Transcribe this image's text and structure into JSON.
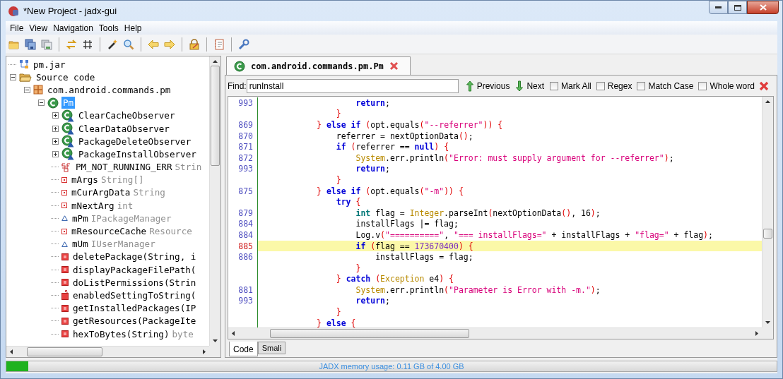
{
  "window": {
    "title": "*New Project - jadx-gui"
  },
  "menu": [
    "File",
    "View",
    "Navigation",
    "Tools",
    "Help"
  ],
  "tree": {
    "items": [
      {
        "label": "pm.jar",
        "kind": "jar",
        "selected": false
      },
      {
        "label": "Source code",
        "kind": "folder",
        "expanded": true,
        "selected": false,
        "children": [
          {
            "label": "com.android.commands.pm",
            "kind": "package",
            "expanded": true,
            "selected": false,
            "children": [
              {
                "label": "Pm",
                "kind": "class",
                "expanded": true,
                "selected": true,
                "children": [
                  {
                    "label": "ClearCacheObserver",
                    "kind": "inner-class",
                    "expanded": false,
                    "selected": false
                  },
                  {
                    "label": "ClearDataObserver",
                    "kind": "inner-class",
                    "expanded": false,
                    "selected": false
                  },
                  {
                    "label": "PackageDeleteObserver",
                    "kind": "inner-class",
                    "expanded": false,
                    "selected": false
                  },
                  {
                    "label": "PackageInstallObserver",
                    "kind": "inner-class",
                    "expanded": false,
                    "selected": false
                  },
                  {
                    "label": "PM_NOT_RUNNING_ERR",
                    "detail": "Strin",
                    "kind": "static-final-field",
                    "selected": false
                  },
                  {
                    "label": "mArgs",
                    "detail": "String[]",
                    "kind": "private-field",
                    "selected": false
                  },
                  {
                    "label": "mCurArgData",
                    "detail": "String",
                    "kind": "private-field",
                    "selected": false
                  },
                  {
                    "label": "mNextArg",
                    "detail": "int",
                    "kind": "private-field",
                    "selected": false
                  },
                  {
                    "label": "mPm",
                    "detail": "IPackageManager",
                    "kind": "package-field",
                    "selected": false
                  },
                  {
                    "label": "mResourceCache",
                    "detail": "Resource",
                    "kind": "private-field",
                    "selected": false
                  },
                  {
                    "label": "mUm",
                    "detail": "IUserManager",
                    "kind": "package-field",
                    "selected": false
                  },
                  {
                    "label": "deletePackage(String, i",
                    "kind": "method",
                    "selected": false
                  },
                  {
                    "label": "displayPackageFilePath(",
                    "kind": "method",
                    "selected": false
                  },
                  {
                    "label": "doListPermissions(Strin",
                    "kind": "method",
                    "selected": false
                  },
                  {
                    "label": "enabledSettingToString(",
                    "kind": "static-method",
                    "selected": false
                  },
                  {
                    "label": "getInstalledPackages(IP",
                    "kind": "method",
                    "selected": false
                  },
                  {
                    "label": "getResources(PackageIte",
                    "kind": "method",
                    "selected": false
                  },
                  {
                    "label": "hexToBytes(String)",
                    "detail": "byte",
                    "kind": "method",
                    "selected": false
                  }
                ]
              }
            ]
          }
        ]
      }
    ]
  },
  "editor_tab": {
    "label": "com.android.commands.pm.Pm",
    "selected": true
  },
  "find_bar": {
    "label": "Find:",
    "value": "runInstall",
    "buttons": [
      {
        "label": "Previous",
        "kind": "up"
      },
      {
        "label": "Next",
        "kind": "down"
      }
    ],
    "options": [
      {
        "label": "Mark All",
        "checked": false
      },
      {
        "label": "Regex",
        "checked": false
      },
      {
        "label": "Match Case",
        "checked": false
      },
      {
        "label": "Whole word",
        "checked": false
      }
    ]
  },
  "code": {
    "lines": [
      {
        "number": "993",
        "highlighted": false,
        "tokens": [
          {
            "text": "                    return",
            "kind": "kw"
          },
          {
            "text": ";",
            "kind": "plain"
          }
        ]
      },
      {
        "highlighted": false,
        "tokens": [
          {
            "text": "                }",
            "kind": "brace"
          }
        ]
      },
      {
        "number": "869",
        "highlighted": false,
        "tokens": [
          {
            "text": "            } ",
            "kind": "brace"
          },
          {
            "text": "else if ",
            "kind": "kw"
          },
          {
            "text": "(",
            "kind": "brace"
          },
          {
            "text": "opt.equals",
            "kind": "plain"
          },
          {
            "text": "(",
            "kind": "brace"
          },
          {
            "text": "\"--referrer\"",
            "kind": "str"
          },
          {
            "text": ")) {",
            "kind": "brace"
          }
        ]
      },
      {
        "number": "870",
        "highlighted": false,
        "tokens": [
          {
            "text": "                referrer = nextOptionData",
            "kind": "plain"
          },
          {
            "text": "()",
            "kind": "brace"
          },
          {
            "text": ";",
            "kind": "plain"
          }
        ]
      },
      {
        "number": "871",
        "highlighted": false,
        "tokens": [
          {
            "text": "                if ",
            "kind": "kw"
          },
          {
            "text": "(",
            "kind": "brace"
          },
          {
            "text": "referrer == ",
            "kind": "plain"
          },
          {
            "text": "null",
            "kind": "kw"
          },
          {
            "text": ") {",
            "kind": "brace"
          }
        ]
      },
      {
        "number": "872",
        "highlighted": false,
        "tokens": [
          {
            "text": "                    System",
            "kind": "type"
          },
          {
            "text": ".err.println",
            "kind": "plain"
          },
          {
            "text": "(",
            "kind": "brace"
          },
          {
            "text": "\"Error: must supply argument for --referrer\"",
            "kind": "str"
          },
          {
            "text": ")",
            "kind": "brace"
          },
          {
            "text": ";",
            "kind": "plain"
          }
        ]
      },
      {
        "number": "993",
        "highlighted": false,
        "tokens": [
          {
            "text": "                    return",
            "kind": "kw"
          },
          {
            "text": ";",
            "kind": "plain"
          }
        ]
      },
      {
        "highlighted": false,
        "tokens": [
          {
            "text": "                }",
            "kind": "brace"
          }
        ]
      },
      {
        "number": "875",
        "highlighted": false,
        "tokens": [
          {
            "text": "            } ",
            "kind": "brace"
          },
          {
            "text": "else if ",
            "kind": "kw"
          },
          {
            "text": "(",
            "kind": "brace"
          },
          {
            "text": "opt.equals",
            "kind": "plain"
          },
          {
            "text": "(",
            "kind": "brace"
          },
          {
            "text": "\"-m\"",
            "kind": "str"
          },
          {
            "text": ")) {",
            "kind": "brace"
          }
        ]
      },
      {
        "highlighted": false,
        "tokens": [
          {
            "text": "                try ",
            "kind": "kw"
          },
          {
            "text": "{",
            "kind": "brace"
          }
        ]
      },
      {
        "number": "879",
        "highlighted": false,
        "tokens": [
          {
            "text": "                    int",
            "kind": "prim"
          },
          {
            "text": " flag = ",
            "kind": "plain"
          },
          {
            "text": "Integer",
            "kind": "type"
          },
          {
            "text": ".parseInt",
            "kind": "plain"
          },
          {
            "text": "(",
            "kind": "brace"
          },
          {
            "text": "nextOptionData",
            "kind": "plain"
          },
          {
            "text": "()",
            "kind": "brace"
          },
          {
            "text": ", 16",
            "kind": "plain"
          },
          {
            "text": ")",
            "kind": "brace"
          },
          {
            "text": ";",
            "kind": "plain"
          }
        ]
      },
      {
        "number": "884",
        "highlighted": false,
        "tokens": [
          {
            "text": "                    installFlags |= flag;",
            "kind": "plain"
          }
        ]
      },
      {
        "number": "884",
        "highlighted": false,
        "tokens": [
          {
            "text": "                    Log.v",
            "kind": "plain"
          },
          {
            "text": "(",
            "kind": "brace"
          },
          {
            "text": "\"==========\"",
            "kind": "str"
          },
          {
            "text": ", ",
            "kind": "plain"
          },
          {
            "text": "\"=== installFlags=\"",
            "kind": "str"
          },
          {
            "text": " + installFlags + ",
            "kind": "plain"
          },
          {
            "text": "\"flag=\"",
            "kind": "str"
          },
          {
            "text": " + flag",
            "kind": "plain"
          },
          {
            "text": ")",
            "kind": "brace"
          },
          {
            "text": ";",
            "kind": "plain"
          }
        ]
      },
      {
        "number": "885",
        "highlighted": true,
        "tokens": [
          {
            "text": "                    if ",
            "kind": "kw"
          },
          {
            "text": "(",
            "kind": "brace"
          },
          {
            "text": "flag == ",
            "kind": "plain"
          },
          {
            "text": "173670400",
            "kind": "num"
          },
          {
            "text": ") {",
            "kind": "brace"
          }
        ]
      },
      {
        "number": "886",
        "highlighted": false,
        "tokens": [
          {
            "text": "                        installFlags = flag;",
            "kind": "plain"
          }
        ]
      },
      {
        "highlighted": false,
        "tokens": [
          {
            "text": "                    }",
            "kind": "brace"
          }
        ]
      },
      {
        "highlighted": false,
        "tokens": [
          {
            "text": "                } ",
            "kind": "brace"
          },
          {
            "text": "catch ",
            "kind": "kw"
          },
          {
            "text": "(",
            "kind": "brace"
          },
          {
            "text": "Exception",
            "kind": "type"
          },
          {
            "text": " e4",
            "kind": "plain"
          },
          {
            "text": ") {",
            "kind": "brace"
          }
        ]
      },
      {
        "number": "881",
        "highlighted": false,
        "tokens": [
          {
            "text": "                    System",
            "kind": "type"
          },
          {
            "text": ".err.println",
            "kind": "plain"
          },
          {
            "text": "(",
            "kind": "brace"
          },
          {
            "text": "\"Parameter is Error with -m.\"",
            "kind": "str"
          },
          {
            "text": ")",
            "kind": "brace"
          },
          {
            "text": ";",
            "kind": "plain"
          }
        ]
      },
      {
        "number": "993",
        "highlighted": false,
        "tokens": [
          {
            "text": "                    return",
            "kind": "kw"
          },
          {
            "text": ";",
            "kind": "plain"
          }
        ]
      },
      {
        "highlighted": false,
        "tokens": [
          {
            "text": "                }",
            "kind": "brace"
          }
        ]
      },
      {
        "highlighted": false,
        "tokens": [
          {
            "text": "            } ",
            "kind": "brace"
          },
          {
            "text": "else ",
            "kind": "kw"
          },
          {
            "text": "{",
            "kind": "brace"
          }
        ]
      }
    ]
  },
  "view_tabs": [
    {
      "label": "Code",
      "selected": true
    },
    {
      "label": "Smali",
      "selected": false
    }
  ],
  "status_bar": {
    "text": "JADX memory usage: 0.11 GB of 4.00 GB",
    "level": 0.028
  }
}
